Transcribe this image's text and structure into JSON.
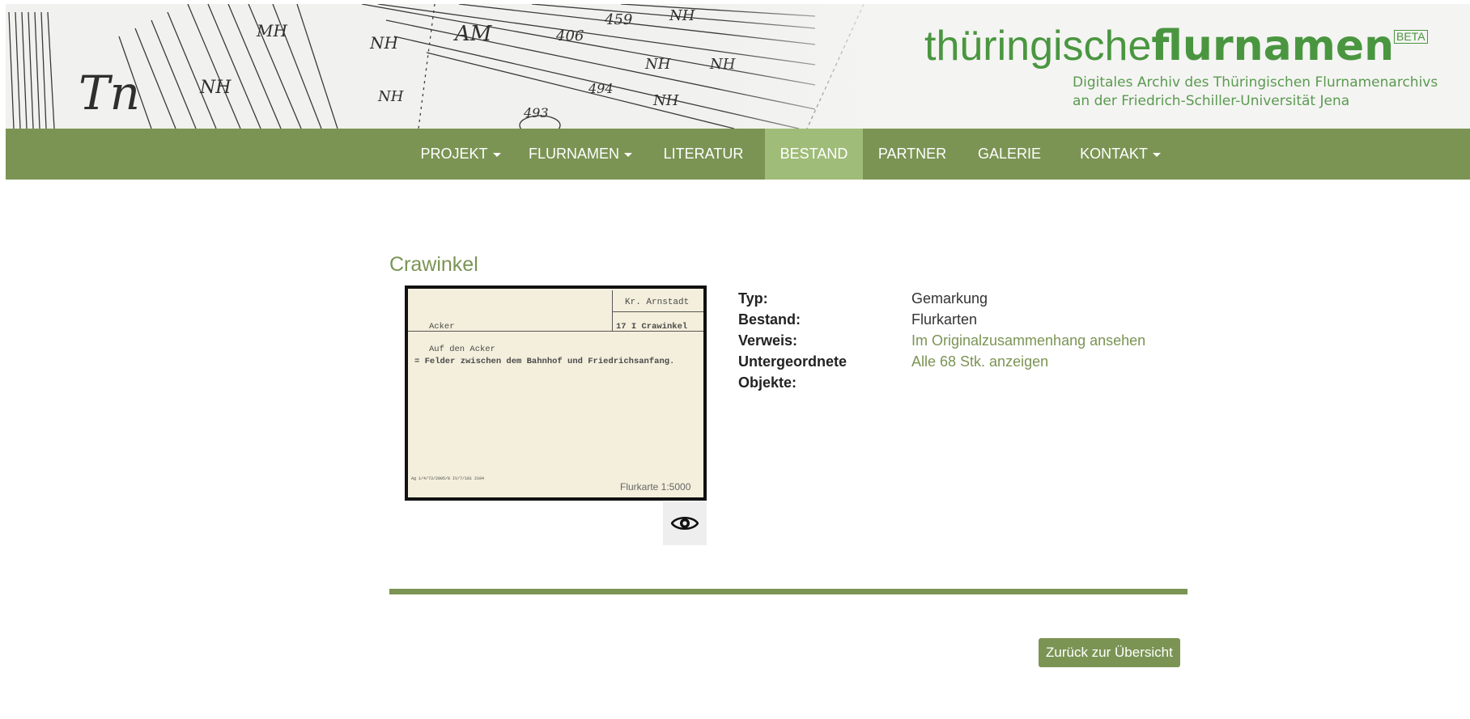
{
  "header": {
    "brand_light": "thüringische",
    "brand_bold": "flurnamen",
    "beta": "BETA",
    "subtitle_line1": "Digitales Archiv des Thüringischen Flurnamenarchivs",
    "subtitle_line2": "an der Friedrich-Schiller-Universität Jena"
  },
  "nav": {
    "items": [
      {
        "label": "PROJEKT",
        "dropdown": true
      },
      {
        "label": "FLURNAMEN",
        "dropdown": true
      },
      {
        "label": "LITERATUR",
        "dropdown": false
      },
      {
        "label": "BESTAND",
        "dropdown": false,
        "active": true
      },
      {
        "label": "PARTNER",
        "dropdown": false
      },
      {
        "label": "GALERIE",
        "dropdown": false
      },
      {
        "label": "KONTAKT",
        "dropdown": true
      }
    ]
  },
  "main": {
    "title": "Crawinkel",
    "card": {
      "top_right": "Kr. Arnstadt",
      "left_label": "Acker",
      "right_label": "17 I Crawinkel",
      "line1": "Auf den Acker",
      "line2": "= Felder zwischen dem Bahnhof und Friedrichsanfang.",
      "footer_left": "Ag 1/4/73/2005/8 IV/7/181 2104",
      "footer_right": "Flurkarte 1:5000"
    },
    "view_icon": "eye-icon",
    "details": {
      "typ_label": "Typ:",
      "typ_value": "Gemarkung",
      "bestand_label": "Bestand:",
      "bestand_value": "Flurkarten",
      "verweis_label": "Verweis:",
      "verweis_value": "Im Originalzusammenhang ansehen",
      "unter_label_1": "Untergeordnete",
      "unter_label_2": "Objekte:",
      "unter_value": "Alle 68 Stk. anzeigen"
    },
    "back_button": "Zurück zur Übersicht"
  },
  "colors": {
    "nav_bg": "#7b9454",
    "nav_active": "#9fbc78",
    "brand_green": "#4a9640",
    "link": "#7b9454"
  }
}
